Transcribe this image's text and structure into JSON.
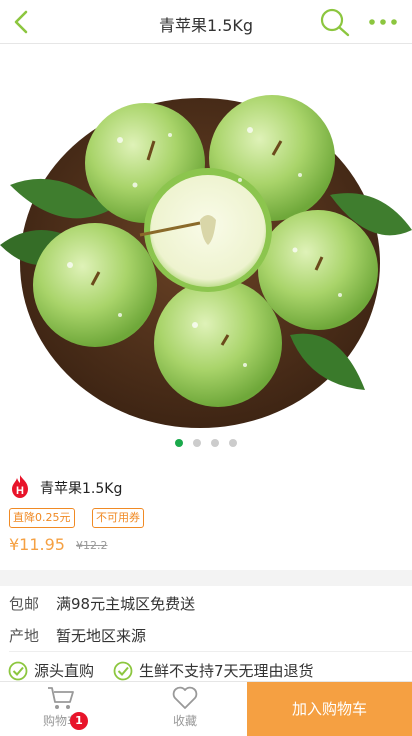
{
  "header": {
    "title": "青苹果1.5Kg",
    "icons": {
      "back": "chevron-left-icon",
      "search": "search-icon",
      "more": "more-dots-icon"
    },
    "accent_color": "#8cc63f"
  },
  "gallery": {
    "image": "green-apples-in-bowl",
    "dot_count": 4,
    "active_index": 0
  },
  "product": {
    "badge_letter": "H",
    "name": "青苹果1.5Kg",
    "tags": [
      "直降0.25元",
      "不可用券"
    ],
    "price": "¥11.95",
    "old_price": "¥12.2",
    "price_color": "#f5a042"
  },
  "details": [
    {
      "label": "包邮",
      "value": "满98元主城区免费送"
    },
    {
      "label": "产地",
      "value": "暂无地区来源"
    }
  ],
  "guarantees": [
    "源头直购",
    "生鲜不支持7天无理由退货"
  ],
  "bottom_bar": {
    "cart_label": "购物车",
    "cart_count": "1",
    "favorite_label": "收藏",
    "add_to_cart_label": "加入购物车"
  }
}
